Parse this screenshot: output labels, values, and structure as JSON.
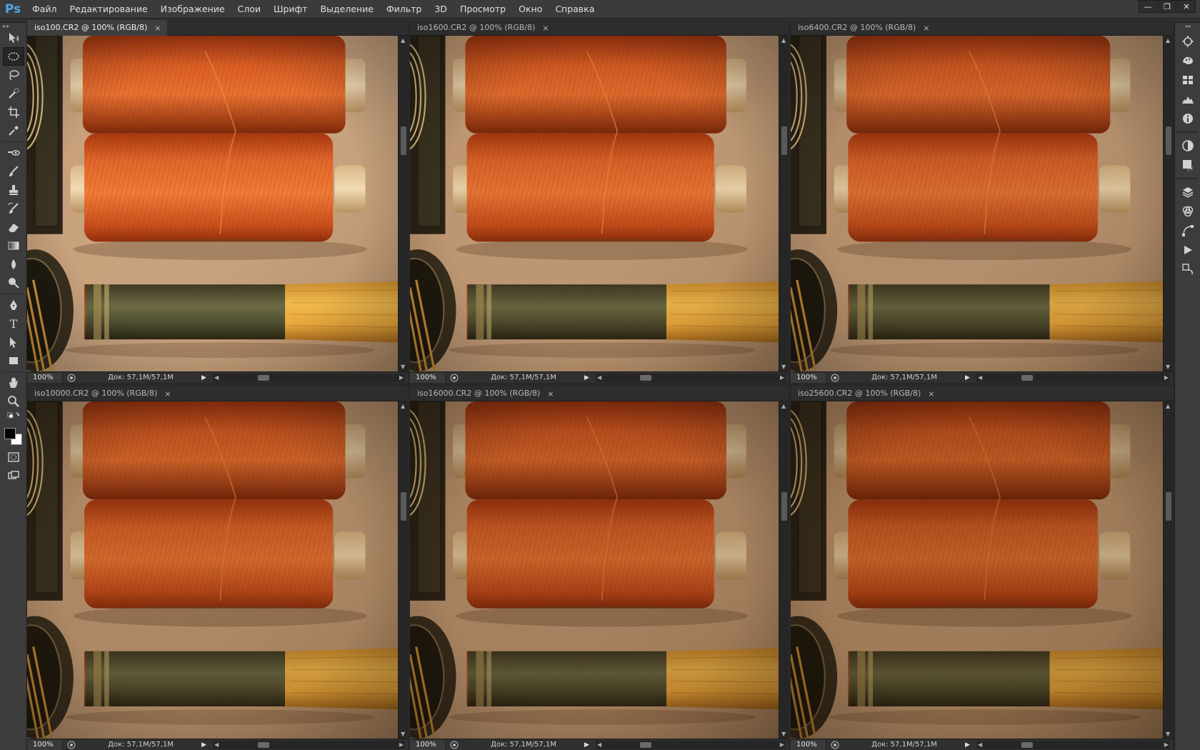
{
  "app": {
    "logo": "Ps"
  },
  "menu": [
    "Файл",
    "Редактирование",
    "Изображение",
    "Слои",
    "Шрифт",
    "Выделение",
    "Фильтр",
    "3D",
    "Просмотр",
    "Окно",
    "Справка"
  ],
  "window_controls": {
    "minimize": "—",
    "restore": "❐",
    "close": "✕"
  },
  "tools": [
    "move-tool",
    "elliptical-marquee-tool",
    "lasso-tool",
    "quick-selection-tool",
    "crop-tool",
    "eyedropper-tool",
    "spot-healing-tool",
    "brush-tool",
    "clone-stamp-tool",
    "history-brush-tool",
    "eraser-tool",
    "gradient-tool",
    "blur-tool",
    "dodge-tool",
    "pen-tool",
    "type-tool",
    "path-selection-tool",
    "rectangle-tool",
    "hand-tool",
    "zoom-tool"
  ],
  "tool_type_glyph": "T",
  "colors": {
    "foreground": "#000000",
    "background": "#ffffff",
    "accent": "#4fa8e8"
  },
  "dock_icons": [
    "color-panel-icon",
    "swatches-icon",
    "styles-icon",
    "histogram-icon",
    "info-icon",
    "adjustments-icon",
    "masks-icon",
    "layers-icon",
    "channels-icon",
    "paths-icon",
    "actions-icon",
    "history-icon"
  ],
  "documents": [
    {
      "title": "iso100.CR2 @ 100% (RGB/8)",
      "close": "×",
      "zoom": "100%",
      "doc_info": "Док: 57,1M/57,1M",
      "noise": 0.0,
      "active": true
    },
    {
      "title": "iso1600.CR2 @ 100% (RGB/8)",
      "close": "×",
      "zoom": "100%",
      "doc_info": "Док: 57,1M/57,1M",
      "noise": 0.25,
      "active": false
    },
    {
      "title": "iso6400.CR2 @ 100% (RGB/8)",
      "close": "×",
      "zoom": "100%",
      "doc_info": "Док: 57,1M/57,1M",
      "noise": 0.45,
      "active": false
    },
    {
      "title": "iso10000.CR2 @ 100% (RGB/8)",
      "close": "×",
      "zoom": "100%",
      "doc_info": "Док: 57,1M/57,1M",
      "noise": 0.6,
      "active": false
    },
    {
      "title": "iso16000.CR2 @ 100% (RGB/8)",
      "close": "×",
      "zoom": "100%",
      "doc_info": "Док: 57,1M/57,1M",
      "noise": 0.75,
      "active": false
    },
    {
      "title": "iso25600.CR2 @ 100% (RGB/8)",
      "close": "×",
      "zoom": "100%",
      "doc_info": "Док: 57,1M/57,1M",
      "noise": 0.95,
      "active": false
    }
  ]
}
